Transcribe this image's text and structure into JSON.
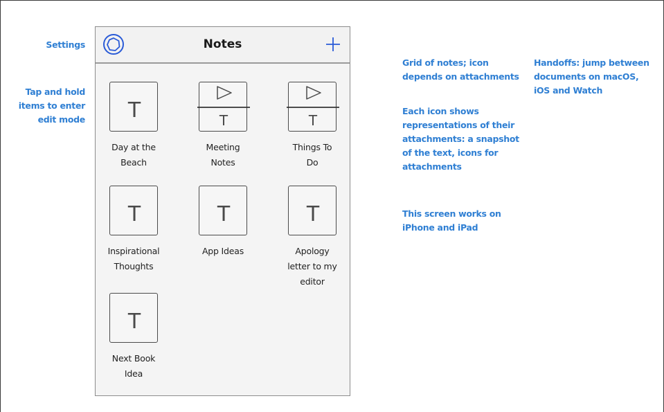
{
  "annotations": {
    "settings": "Settings",
    "tap_hold": [
      "Tap and hold",
      "items to enter",
      "edit mode"
    ],
    "grid": [
      "Grid of notes; icon",
      "depends on attachments"
    ],
    "icons": [
      "Each icon shows",
      "representations of their",
      "attachments: a snapshot",
      "of the text, icons for",
      "attachments"
    ],
    "platforms": [
      "This screen works on",
      "iPhone and iPad"
    ],
    "handoffs": [
      "Handoffs: jump between",
      "documents on macOS,",
      "iOS and Watch"
    ]
  },
  "navbar": {
    "title": "Notes",
    "settings_icon": "settings-circle-icon",
    "add_icon": "plus-icon",
    "accent_color": "#2a5bd7"
  },
  "notes": [
    {
      "label_lines": [
        "Day at the",
        "Beach"
      ],
      "icon": "text-icon",
      "has_attachment": false
    },
    {
      "label_lines": [
        "Meeting",
        "Notes"
      ],
      "icon": "play-attachment-text-icon",
      "has_attachment": true
    },
    {
      "label_lines": [
        "Things To",
        "Do"
      ],
      "icon": "play-attachment-text-icon",
      "has_attachment": true
    },
    {
      "label_lines": [
        "Inspirational",
        "Thoughts"
      ],
      "icon": "text-icon",
      "has_attachment": false
    },
    {
      "label_lines": [
        "App Ideas"
      ],
      "icon": "text-icon",
      "has_attachment": false
    },
    {
      "label_lines": [
        "Apology",
        "letter to my",
        "editor"
      ],
      "icon": "text-icon",
      "has_attachment": false
    },
    {
      "label_lines": [
        "Next Book",
        "Idea"
      ],
      "icon": "text-icon",
      "has_attachment": false
    }
  ],
  "glyph": "T"
}
